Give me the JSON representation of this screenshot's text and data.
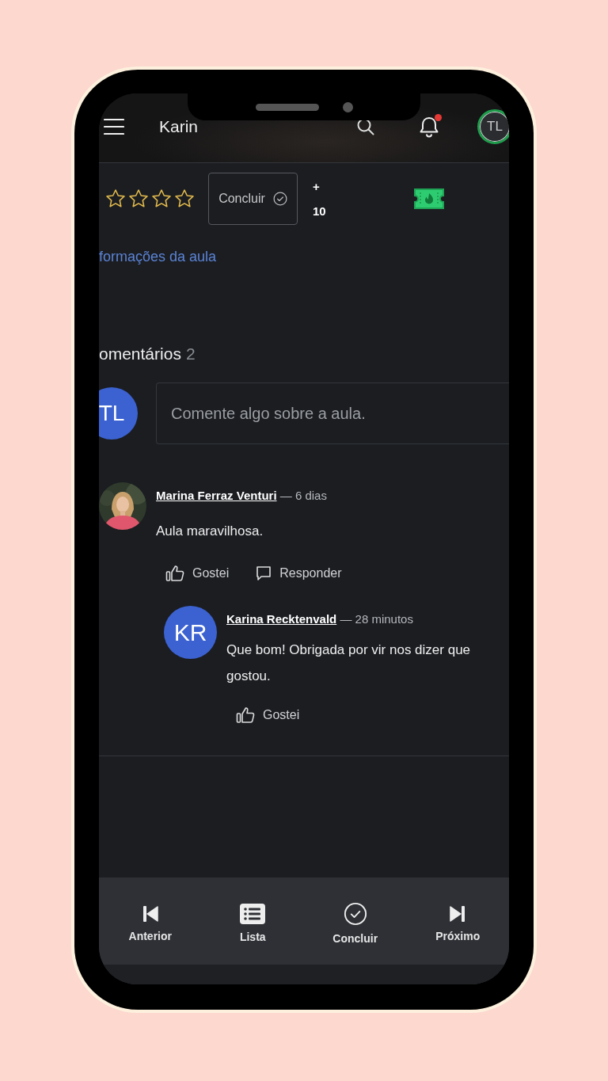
{
  "header": {
    "title": "Karin",
    "avatar_initials": "TL",
    "notification_dot": true
  },
  "lesson": {
    "stars": 0,
    "complete_button": "Concluir",
    "points_sign": "+",
    "points": "10",
    "info_link": "formações da aula"
  },
  "comments": {
    "heading": "omentários",
    "count": "2",
    "input_avatar": "TL",
    "input": {
      "placeholder": "Comente algo sobre a aula."
    },
    "items": [
      {
        "author": "Marina Ferraz Venturi",
        "time": "— 6 dias",
        "text": "Aula maravilhosa.",
        "avatar": {
          "kind": "picture"
        },
        "actions": [
          {
            "kind": "like",
            "label": "Gostei"
          },
          {
            "kind": "reply",
            "label": "Responder"
          }
        ],
        "replies": [
          {
            "author": "Karina Recktenvald",
            "time": "— 28 minutos",
            "text": "Que bom! Obrigada por vir nos dizer que gostou.",
            "avatar": {
              "kind": "initials",
              "initials": "KR"
            },
            "actions": [
              {
                "kind": "like",
                "label": "Gostei"
              }
            ]
          }
        ]
      }
    ]
  },
  "bottom_nav": [
    {
      "kind": "previous",
      "label": "Anterior"
    },
    {
      "kind": "list",
      "label": "Lista"
    },
    {
      "kind": "complete",
      "label": "Concluir"
    },
    {
      "kind": "next",
      "label": "Próximo"
    }
  ]
}
